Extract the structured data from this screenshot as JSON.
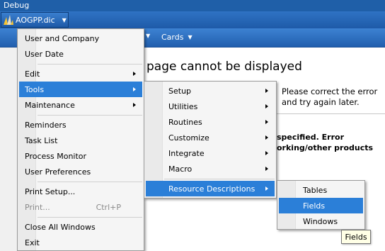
{
  "window": {
    "title": "Debug"
  },
  "dictionary": {
    "label": "AOGPP.dic"
  },
  "navbar": {
    "cards_label": "Cards"
  },
  "content": {
    "title": "page cannot be displayed",
    "p1": "Please correct the error and try again later.",
    "p2_line1": "specified. Error",
    "p2_line2": "orking/other products"
  },
  "main_menu": {
    "items": [
      {
        "label": "User and Company"
      },
      {
        "label": "User Date"
      },
      {
        "label": "Edit"
      },
      {
        "label": "Tools"
      },
      {
        "label": "Maintenance"
      },
      {
        "label": "Reminders"
      },
      {
        "label": "Task List"
      },
      {
        "label": "Process Monitor"
      },
      {
        "label": "User Preferences"
      },
      {
        "label": "Print Setup..."
      },
      {
        "label": "Print...",
        "shortcut": "Ctrl+P"
      },
      {
        "label": "Close All Windows"
      },
      {
        "label": "Exit"
      }
    ]
  },
  "tools_menu": {
    "items": [
      {
        "label": "Setup"
      },
      {
        "label": "Utilities"
      },
      {
        "label": "Routines"
      },
      {
        "label": "Customize"
      },
      {
        "label": "Integrate"
      },
      {
        "label": "Macro"
      },
      {
        "label": "Resource Descriptions"
      }
    ]
  },
  "resource_menu": {
    "items": [
      {
        "label": "Tables"
      },
      {
        "label": "Fields"
      },
      {
        "label": "Windows"
      }
    ]
  },
  "tooltip": {
    "text": "Fields"
  },
  "colors": {
    "title_bar": "#1f5fa8",
    "nav_bar": "#3d82d2",
    "selection": "#2b7fd8",
    "menu_bg": "#f5f5f5"
  }
}
